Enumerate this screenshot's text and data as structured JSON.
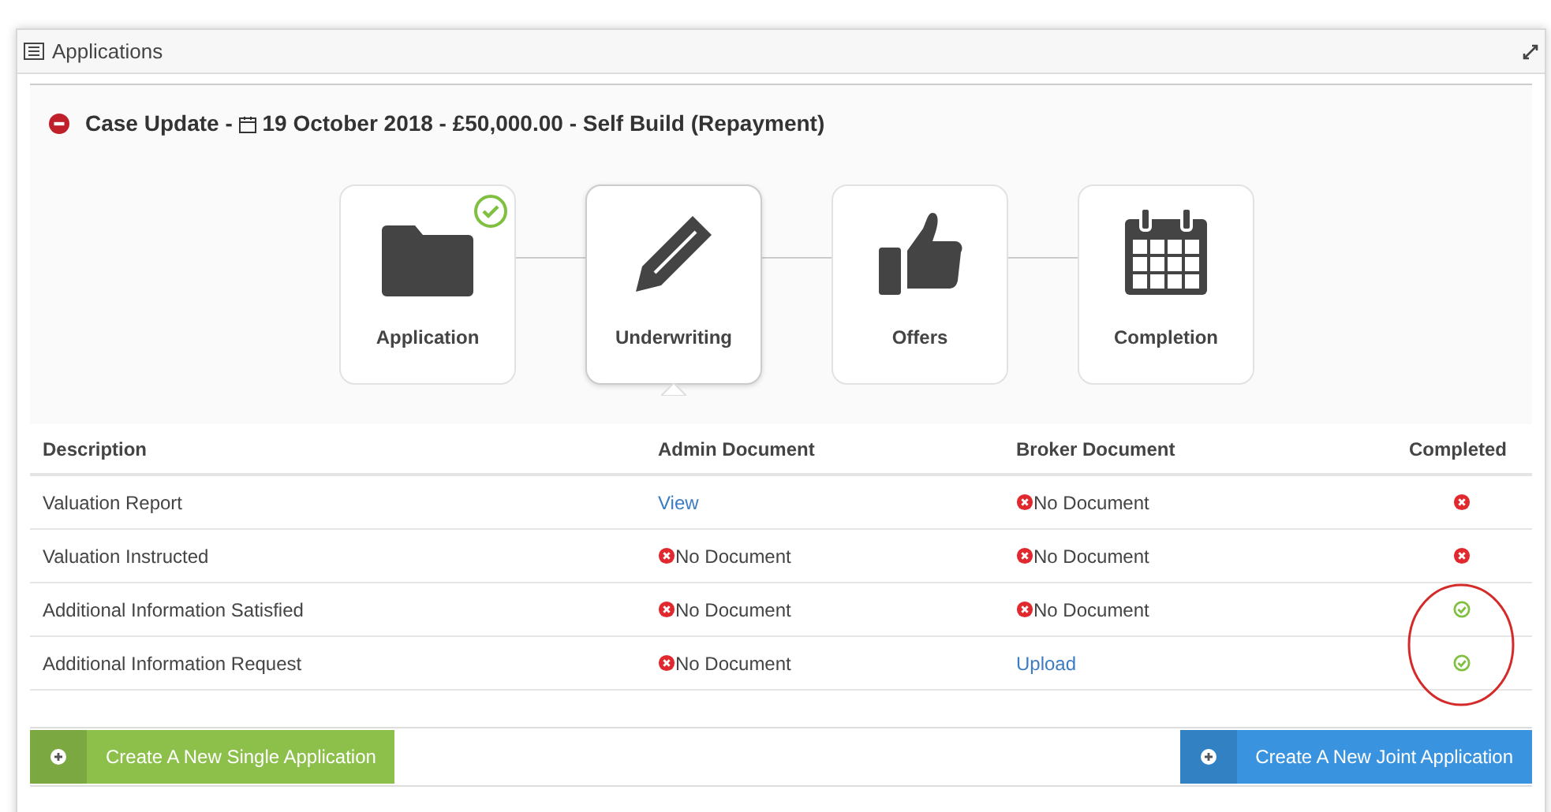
{
  "panel": {
    "title": "Applications"
  },
  "case": {
    "prefix": "Case Update - ",
    "date": "19 October 2018",
    "suffix": " - £50,000.00 - Self Build (Repayment)"
  },
  "steps": [
    {
      "label": "Application",
      "kind": "folder",
      "done": true,
      "selected": false
    },
    {
      "label": "Underwriting",
      "kind": "pencil",
      "done": false,
      "selected": true
    },
    {
      "label": "Offers",
      "kind": "thumb",
      "done": false,
      "selected": false
    },
    {
      "label": "Completion",
      "kind": "calendar",
      "done": false,
      "selected": false
    }
  ],
  "table": {
    "columns": [
      "Description",
      "Admin Document",
      "Broker Document",
      "Completed"
    ],
    "rows": [
      {
        "description": "Valuation Report",
        "admin": {
          "kind": "link",
          "text": "View"
        },
        "broker": {
          "kind": "missing",
          "text": "No Document"
        },
        "completed": false,
        "highlighted": false
      },
      {
        "description": "Valuation Instructed",
        "admin": {
          "kind": "missing",
          "text": "No Document"
        },
        "broker": {
          "kind": "missing",
          "text": "No Document"
        },
        "completed": false,
        "highlighted": false
      },
      {
        "description": "Additional Information Satisfied",
        "admin": {
          "kind": "missing",
          "text": "No Document"
        },
        "broker": {
          "kind": "missing",
          "text": "No Document"
        },
        "completed": true,
        "highlighted": true
      },
      {
        "description": "Additional Information Request",
        "admin": {
          "kind": "missing",
          "text": "No Document"
        },
        "broker": {
          "kind": "link",
          "text": "Upload"
        },
        "completed": true,
        "highlighted": true
      }
    ]
  },
  "buttons": [
    {
      "label": "Create A New Single Application",
      "color": "#8dc04a"
    },
    {
      "label": "Create A New Joint Application",
      "color": "#3a93de"
    }
  ]
}
